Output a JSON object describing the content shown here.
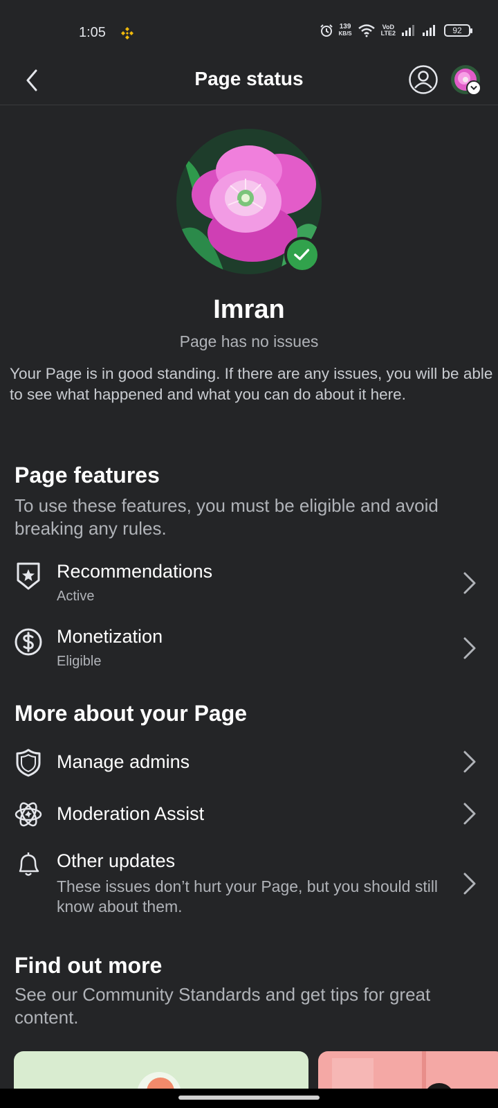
{
  "status_bar": {
    "time": "1:05",
    "net_speed_value": "139",
    "net_speed_unit": "KB/S",
    "volte": "VoD\nLTE2",
    "battery": "92"
  },
  "header": {
    "title": "Page status"
  },
  "profile": {
    "name": "Imran",
    "status": "Page has no issues",
    "description": "Your Page is in good standing. If there are any issues, you will be able to see what happened and what you can do about it here."
  },
  "features": {
    "title": "Page features",
    "subtitle": "To use these features, you must be eligible and avoid breaking any rules.",
    "items": [
      {
        "title": "Recommendations",
        "status": "Active",
        "icon": "shield-star-icon"
      },
      {
        "title": "Monetization",
        "status": "Eligible",
        "icon": "dollar-circle-icon"
      }
    ]
  },
  "more": {
    "title": "More about your Page",
    "items": [
      {
        "title": "Manage admins",
        "icon": "shield-icon"
      },
      {
        "title": "Moderation Assist",
        "icon": "atom-gear-icon"
      },
      {
        "title": "Other updates",
        "description": "These issues don’t hurt your Page, but you should still know about them.",
        "icon": "bell-icon"
      }
    ]
  },
  "find_out": {
    "title": "Find out more",
    "subtitle": "See our Community Standards and get tips for great content."
  },
  "colors": {
    "background": "#242527",
    "verified": "#31a24c",
    "binance": "#f0b90b"
  }
}
